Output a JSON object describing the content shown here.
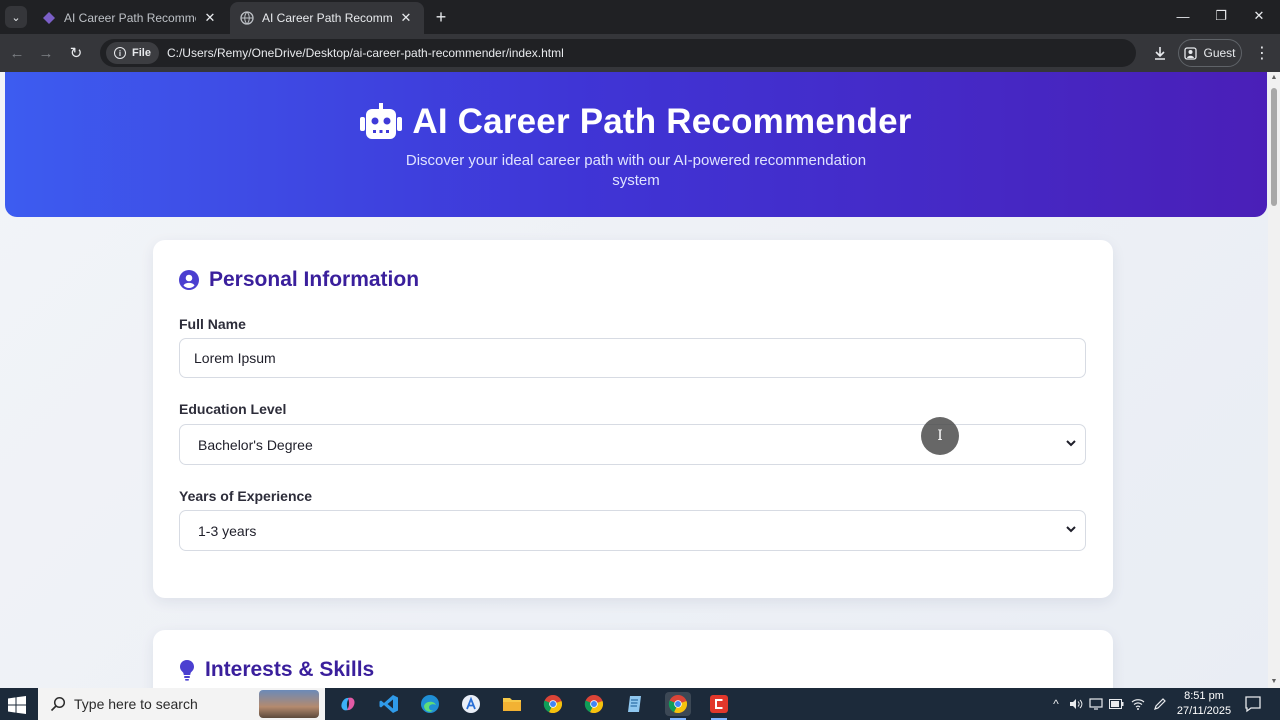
{
  "browser": {
    "tabs": [
      {
        "title": "AI Career Path Recommender U",
        "active": false
      },
      {
        "title": "AI Career Path Recommender",
        "active": true
      }
    ],
    "chip_label": "File",
    "url": "C:/Users/Remy/OneDrive/Desktop/ai-career-path-recommender/index.html",
    "profile_label": "Guest"
  },
  "hero": {
    "title": "AI Career Path Recommender",
    "subtitle": "Discover your ideal career path with our AI-powered recommendation system"
  },
  "personal": {
    "heading": "Personal Information",
    "full_name_label": "Full Name",
    "full_name_value": "Lorem Ipsum",
    "education_label": "Education Level",
    "education_value": "Bachelor's Degree",
    "experience_label": "Years of Experience",
    "experience_value": "1-3 years"
  },
  "interests": {
    "heading": "Interests & Skills"
  },
  "taskbar": {
    "search_placeholder": "Type here to search",
    "time": "8:51 pm",
    "date": "27/11/2025"
  },
  "colors": {
    "hero_start": "#3d5cf0",
    "hero_end": "#4a1fb8",
    "heading": "#3a1f9c"
  }
}
